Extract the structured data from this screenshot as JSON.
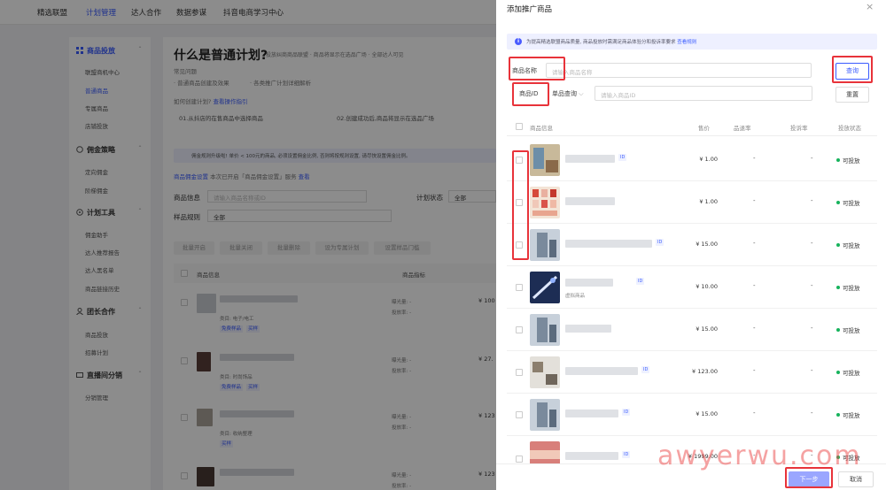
{
  "topnav": {
    "items": [
      "精选联盟",
      "计划管理",
      "达人合作",
      "数据参谋",
      "抖音电商学习中心"
    ],
    "active_index": 1
  },
  "sidebar": {
    "groups": [
      {
        "label": "商品投放",
        "items": [
          "联盟商机中心",
          "普通商品",
          "专属商品",
          "店铺投放"
        ]
      },
      {
        "label": "佣金策略",
        "items": [
          "定向佣金",
          "阶梯佣金"
        ]
      },
      {
        "label": "计划工具",
        "items": [
          "佣金助手",
          "达人推荐报告",
          "达人黑名单",
          "商品链接历史"
        ]
      },
      {
        "label": "团长合作",
        "items": [
          "商品投放",
          "招募计划"
        ]
      },
      {
        "label": "直播间分销",
        "items": [
          "分销管理"
        ]
      }
    ],
    "active_item": "普通商品"
  },
  "main": {
    "title": "什么是普通计划?",
    "title_sub": "投放纠商商品联盟 · 商品将显示在选品广场 · 全部达人可见",
    "help_label": "常见问题",
    "help_line1": "· 普通商品创建及效果",
    "help_line1_extra": "· 各类推广计划详细解析",
    "guide_question": "如何创建计划?",
    "guide_link": "查看操作指引",
    "step1": "01.从抖店的在售商品中选择商品",
    "step2": "02.创建成功后,商品将显示在选品广场",
    "notice": "佣金规则升级啦! 单价 < 100元的商品, 必须设置佣金比例, 否则将按规则设置, 请尽快设置佣金比例。",
    "commission_link": "商品佣金设置",
    "commission_text": "本次已开启「商品佣金设置」服务",
    "commission_link2": "查看",
    "filter": {
      "product_label": "商品信息",
      "product_placeholder": "请输入商品名称或ID",
      "status_label": "计划状态",
      "status_value": "全部",
      "rule_label": "样品规则",
      "rule_value": "全部"
    },
    "batch_buttons": [
      "批量开启",
      "批量关闭",
      "批量删除",
      "设为专属计划",
      "设置样品门槛"
    ],
    "table_headers": [
      "商品信息",
      "商品指标"
    ],
    "rows": [
      {
        "category": "类目: 电子/电工",
        "tags": [
          "免费样品",
          "买样"
        ],
        "metric1": "曝光量: -",
        "metric2": "投放率: -",
        "price": "¥ 100"
      },
      {
        "category": "类目: 时尚饰品",
        "tags": [
          "免费样品",
          "买样"
        ],
        "metric1": "曝光量: -",
        "metric2": "投放率: -",
        "price": "¥ 27."
      },
      {
        "category": "类目: 收纳整理",
        "tags": [
          "买样"
        ],
        "metric1": "曝光量: -",
        "metric2": "投放率: -",
        "price": "¥ 123"
      },
      {
        "category": "",
        "tags": [],
        "metric1": "曝光量: -",
        "metric2": "投放率: -",
        "price": "¥ 123"
      }
    ]
  },
  "drawer": {
    "title": "添加推广商品",
    "close": "×",
    "tip": "为提高精选联盟商品质量, 商品投放时需满足商品体验分和投诉率要求",
    "tip_link": "查看规则",
    "name_label": "商品名称",
    "name_placeholder": "请输入商品名称",
    "id_label": "商品ID",
    "mode_select": "单品查询",
    "id_placeholder": "请输入商品ID",
    "query_button": "查询",
    "reset_button": "重置",
    "columns": [
      "商品信息",
      "售价",
      "品退率",
      "投诉率",
      "投放状态"
    ],
    "rows": [
      {
        "id_tag": "ID",
        "sub": "",
        "price": "¥ 1.00",
        "return_rate": "-",
        "complaint_rate": "-",
        "status": "可投放"
      },
      {
        "id_tag": "ID",
        "sub": "",
        "price": "¥ 1.00",
        "return_rate": "-",
        "complaint_rate": "-",
        "status": "可投放"
      },
      {
        "id_tag": "ID",
        "sub": "",
        "price": "¥ 15.00",
        "return_rate": "-",
        "complaint_rate": "-",
        "status": "可投放"
      },
      {
        "id_tag": "ID",
        "sub": "虚拟商品",
        "price": "¥ 10.00",
        "return_rate": "-",
        "complaint_rate": "-",
        "status": "可投放"
      },
      {
        "id_tag": "ID",
        "sub": "",
        "price": "¥ 15.00",
        "return_rate": "-",
        "complaint_rate": "-",
        "status": "可投放"
      },
      {
        "id_tag": "ID",
        "sub": "",
        "price": "¥ 123.00",
        "return_rate": "-",
        "complaint_rate": "-",
        "status": "可投放"
      },
      {
        "id_tag": "ID",
        "sub": "",
        "price": "¥ 15.00",
        "return_rate": "-",
        "complaint_rate": "-",
        "status": "可投放"
      },
      {
        "id_tag": "ID",
        "sub": "",
        "price": "¥ 1999.00",
        "return_rate": "-",
        "complaint_rate": "-",
        "status": "可投放"
      }
    ],
    "next_button": "下一步",
    "cancel_button": "取消"
  },
  "watermark": "awyerwu.com",
  "colors": {
    "accent": "#3a5bff",
    "highlight": "#e8333a",
    "status_ok": "#17b35c"
  }
}
